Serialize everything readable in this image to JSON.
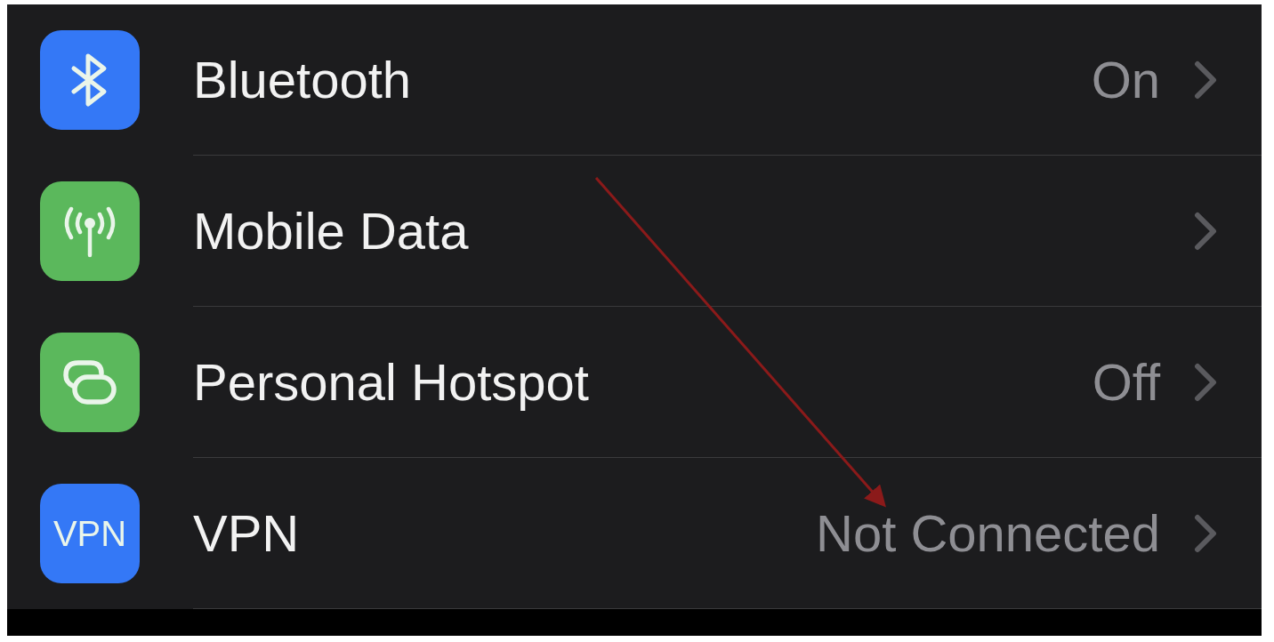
{
  "settings_rows": [
    {
      "kind": "bluetooth",
      "color": "#3478f6",
      "label": "Bluetooth",
      "value": "On"
    },
    {
      "kind": "antenna",
      "color": "#5bb85c",
      "label": "Mobile Data"
    },
    {
      "kind": "chain",
      "color": "#5bb85c",
      "label": "Personal Hotspot",
      "value": "Off"
    },
    {
      "kind": "text",
      "icon_text": "VPN",
      "color": "#3478f6",
      "label": "VPN",
      "value": "Not Connected"
    }
  ]
}
